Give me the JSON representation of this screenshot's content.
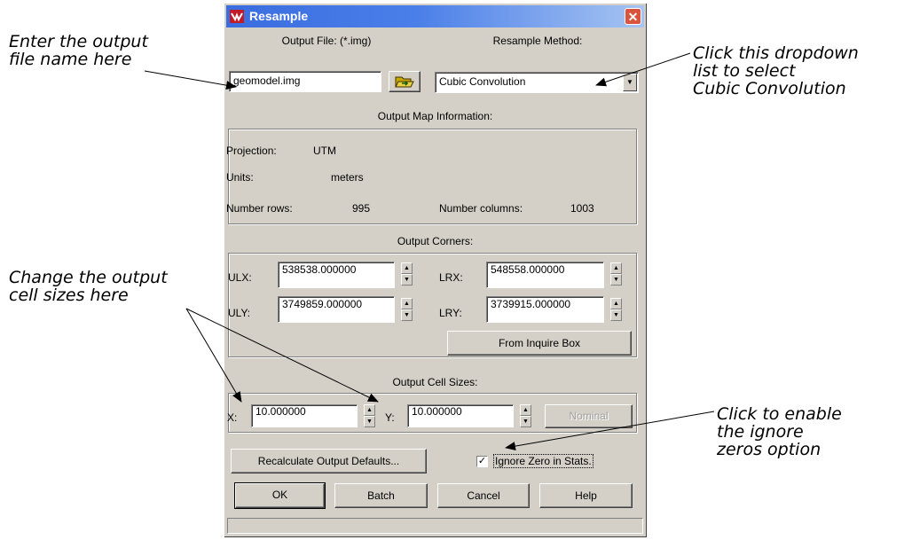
{
  "annotations": {
    "output_file": [
      "Enter the output",
      "file name here"
    ],
    "dropdown": [
      "Click this dropdown",
      "list to select",
      "Cubic Convolution"
    ],
    "cell_sizes": [
      "Change the output",
      "cell sizes here"
    ],
    "ignore_zeros": [
      "Click to enable",
      "the ignore",
      "zeros option"
    ]
  },
  "dialog": {
    "title": "Resample",
    "close_glyph": "✕",
    "output_file_label": "Output File: (*.img)",
    "output_file_value": "geomodel.img",
    "resample_method_label": "Resample Method:",
    "resample_method_value": "Cubic Convolution",
    "output_map_info_label": "Output Map Information:",
    "projection_label": "Projection:",
    "projection_value": "UTM",
    "units_label": "Units:",
    "units_value": "meters",
    "number_rows_label": "Number rows:",
    "number_rows_value": "995",
    "number_columns_label": "Number columns:",
    "number_columns_value": "1003",
    "output_corners_label": "Output Corners:",
    "ulx_label": "ULX:",
    "ulx_value": "538538.000000",
    "lrx_label": "LRX:",
    "lrx_value": "548558.000000",
    "uly_label": "ULY:",
    "uly_value": "3749859.000000",
    "lry_label": "LRY:",
    "lry_value": "3739915.000000",
    "from_inquire_box_label": "From Inquire Box",
    "output_cell_sizes_label": "Output Cell Sizes:",
    "x_label": "X:",
    "x_value": "10.000000",
    "y_label": "Y:",
    "y_value": "10.000000",
    "nominal_label": "Nominal",
    "recalculate_label": "Recalculate Output Defaults...",
    "ignore_zero_label": "Ignore Zero in Stats.",
    "ignore_zero_checked": "✓",
    "ok_label": "OK",
    "batch_label": "Batch",
    "cancel_label": "Cancel",
    "help_label": "Help"
  },
  "colors": {
    "titlebar_start": "#3a6ee0",
    "titlebar_end": "#a6c4f2",
    "dialog_face": "#d4d0c8",
    "close_button": "#d9543c"
  },
  "icons": {
    "app": "erdas-app-icon",
    "folder": "open-folder-icon",
    "close": "close-icon",
    "dropdown": "chevron-down-icon",
    "spin_up": "spin-up-icon",
    "spin_down": "spin-down-icon"
  }
}
